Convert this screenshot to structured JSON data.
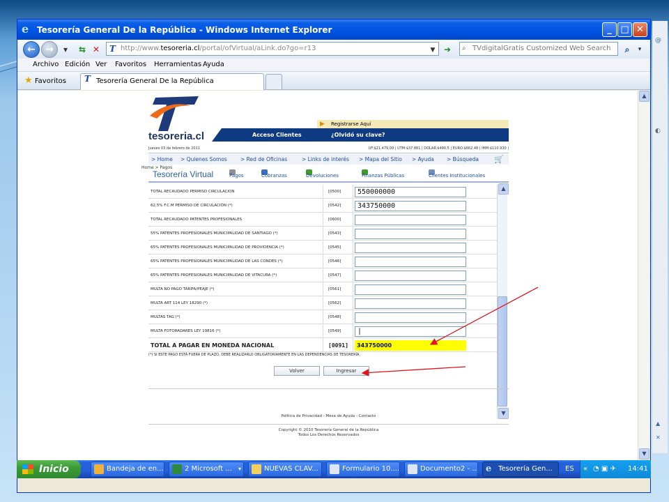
{
  "window": {
    "title": "Tesorería General De la República - Windows Internet Explorer"
  },
  "address": {
    "prefix": "http://www.",
    "domain": "tesoreria.cl",
    "path": "/portal/ofVirtual/aLink.do?go=r13"
  },
  "search": {
    "placeholder": "TVdigitalGratis Customized Web Search"
  },
  "menu": [
    "Archivo",
    "Edición",
    "Ver",
    "Favoritos",
    "Herramientas",
    "Ayuda"
  ],
  "favorites": {
    "label": "Favoritos"
  },
  "tab": {
    "label": "Tesorería General De la República"
  },
  "site": {
    "logo_text": "tesoreria.cl",
    "register": "Registrarse Aquí",
    "clients": "Acceso Clientes",
    "forgot": "¿Olvidó su clave?",
    "date": "Jueves 03 de febrero de 2011",
    "indicators": "UF:$21.479,09 | UTM:$37.881 | DOLAR:$480,5 | EURO:$662,48 | IMM:$110.930 |",
    "nav": [
      "> Home",
      "> Quienes Somos",
      "> Red de Oficinas",
      "> Links de interés",
      "> Mapa del Sitio",
      "> Ayuda",
      "> Búsqueda"
    ],
    "breadcrumb": "Home > Pagos",
    "virtual_title": "Tesorería Virtual",
    "services": [
      "Pagos",
      "Cobranzas",
      "Devoluciones",
      "Finanzas Públicas",
      "Clientes Institucionales"
    ]
  },
  "form": {
    "rows": [
      {
        "label": "TOTAL RECAUDADO PERMISO CIRCULACION",
        "code": "[0500]",
        "value": "550000000"
      },
      {
        "label": "62,5% F.C.M PERMISO DE CIRCULACIÓN (*)",
        "code": "[0542]",
        "value": "343750000"
      },
      {
        "label": "TOTAL RECAUDADO PATENTES PROFESIONALES",
        "code": "[0600]",
        "value": ""
      },
      {
        "label": "55% PATENTES PROFESIONALES MUNICIPALIDAD DE SANTIAGO (*)",
        "code": "[0543]",
        "value": ""
      },
      {
        "label": "65% PATENTES PROFESIONALES MUNICIPALIDAD DE PROVIDENCIA (*)",
        "code": "[0545]",
        "value": ""
      },
      {
        "label": "65% PATENTES PROFESIONALES MUNICIPALIDAD DE LAS CONDES (*)",
        "code": "[0546]",
        "value": ""
      },
      {
        "label": "65% PATENTES PROFESIONALES MUNICIPALIDAD DE VITACURA (*)",
        "code": "[0547]",
        "value": ""
      },
      {
        "label": "MULTA NO PAGO TARIFA/PEAJE (*)",
        "code": "[0561]",
        "value": ""
      },
      {
        "label": "MULTA ART 114 LEY 18290 (*)",
        "code": "[0562]",
        "value": ""
      },
      {
        "label": "MULTAS TAG (*)",
        "code": "[0548]",
        "value": ""
      },
      {
        "label": "MULTA FOTORADARES LEY 19816 (*)",
        "code": "[0549]",
        "value": "|"
      }
    ],
    "total": {
      "label": "TOTAL A PAGAR EN MONEDA NACIONAL",
      "code": "[0091]",
      "value": "343750000"
    },
    "note": "(*) SI ESTE PAGO ESTÁ FUERA DE PLAZO, DEBE REALIZARLO OBLIGATORIAMENTE EN LAS DEPENDENCIAS DE TESORERÍA.",
    "back_label": "Volver",
    "submit_label": "Ingresar"
  },
  "footer": {
    "links": "Política de Privacidad - Mesa de Ayuda - Contacto",
    "copyright": "Copyright © 2010 Tesorería General de la República",
    "rights": "Todos Los Derechos Reservados"
  },
  "taskbar": {
    "start": "Inicio",
    "items": [
      "Bandeja de en...",
      "2 Microsoft ...",
      "NUEVAS CLAV...",
      "Formulario 10....",
      "Documento2 - ...",
      "Tesorería Gen..."
    ],
    "lang": "ES",
    "time": "14:41"
  },
  "colors": {
    "accent": "#0d3a80",
    "highlight": "#ffff00",
    "annotation": "#e0141e"
  }
}
